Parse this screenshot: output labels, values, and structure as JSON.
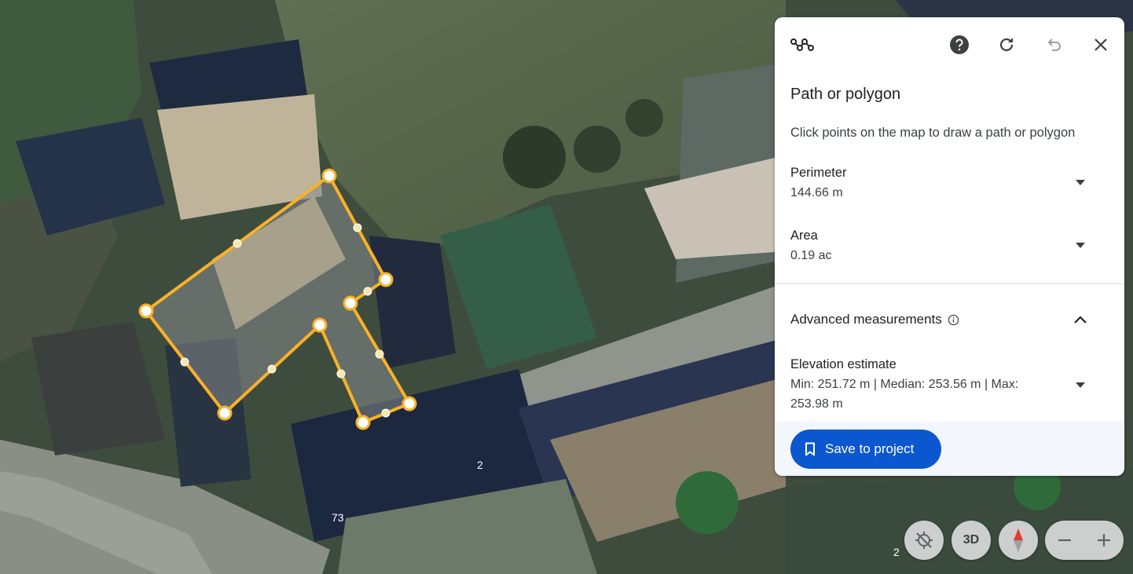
{
  "map": {
    "house_numbers": [
      "2",
      "73",
      "2"
    ],
    "polygon_color": "#f9b128"
  },
  "panel": {
    "tool_icon": "path-tool-icon",
    "help_icon": "help-icon",
    "reset_icon": "refresh-icon",
    "undo_icon": "undo-icon",
    "close_icon": "close-icon",
    "title": "Path or polygon",
    "instruction": "Click points on the map to draw a path or polygon",
    "perimeter": {
      "label": "Perimeter",
      "value": "144.66 m"
    },
    "area": {
      "label": "Area",
      "value": "0.19 ac"
    },
    "advanced": {
      "label": "Advanced measurements",
      "info_icon": "info-icon",
      "expanded": true
    },
    "elevation": {
      "label": "Elevation estimate",
      "value": "Min: 251.72 m | Median: 253.56 m | Max: 253.98 m"
    },
    "save_button": {
      "label": "Save to project",
      "icon": "bookmark-icon",
      "color": "#0b57d0"
    }
  },
  "controls": {
    "location_icon": "location-off-icon",
    "three_d_label": "3D",
    "compass_icon": "compass-icon",
    "zoom_out_icon": "minus-icon",
    "zoom_in_icon": "plus-icon"
  }
}
